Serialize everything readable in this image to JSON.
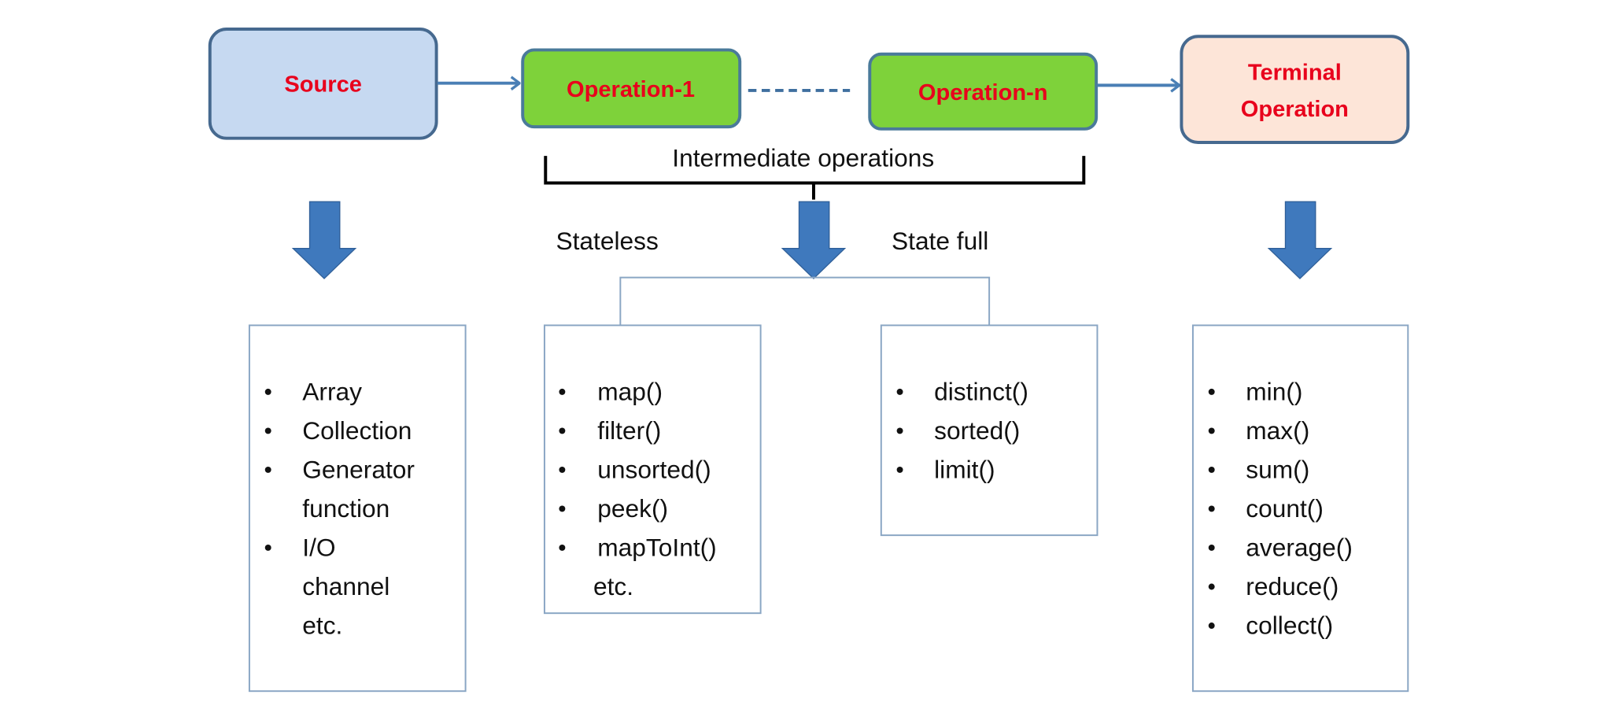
{
  "colors": {
    "source_fill": "#c6d9f1",
    "operation_fill": "#7ed23a",
    "terminal_fill": "#fde5d8",
    "box_stroke": "#46698f",
    "header_text": "#e8001c",
    "arrow": "#3f79bd",
    "list_box_stroke": "#8aa6c4"
  },
  "nodes": {
    "source": "Source",
    "operation_1": "Operation-1",
    "operation_n": "Operation-n",
    "terminal_line1": "Terminal",
    "terminal_line2": "Operation"
  },
  "labels": {
    "intermediate": "Intermediate operations",
    "stateless": "Stateless",
    "stateful": "State full"
  },
  "lists": {
    "source": [
      "Array",
      "Collection",
      "Generator",
      "function",
      "I/O",
      "channel",
      "etc."
    ],
    "source_bullets": [
      true,
      true,
      true,
      false,
      true,
      false,
      false
    ],
    "stateless": [
      "map()",
      "filter()",
      "unsorted()",
      "peek()",
      "mapToInt()",
      "etc."
    ],
    "stateless_bullets": [
      true,
      true,
      true,
      true,
      true,
      false
    ],
    "stateful": [
      "distinct()",
      "sorted()",
      "limit()"
    ],
    "stateful_bullets": [
      true,
      true,
      true
    ],
    "terminal": [
      "min()",
      "max()",
      "sum()",
      "count()",
      "average()",
      "reduce()",
      "collect()"
    ],
    "terminal_bullets": [
      true,
      true,
      true,
      true,
      true,
      true,
      true
    ]
  }
}
